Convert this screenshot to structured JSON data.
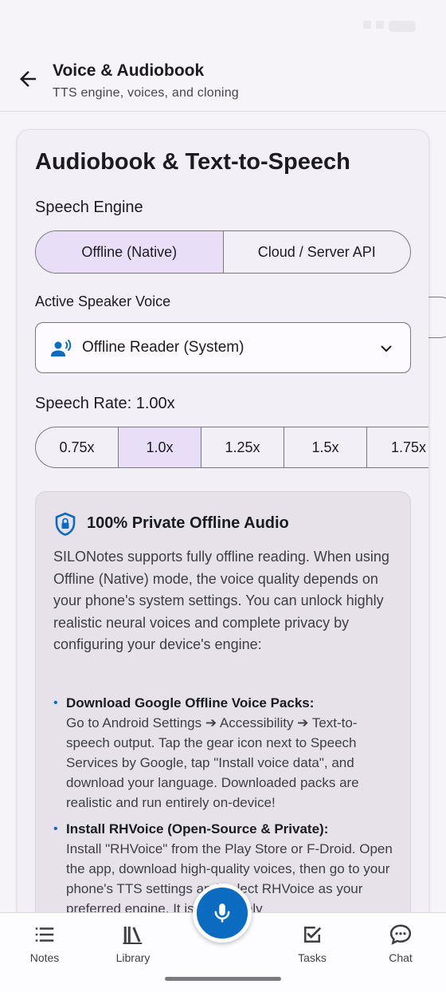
{
  "header": {
    "title": "Voice & Audiobook",
    "subtitle": "TTS engine, voices, and cloning",
    "back_icon": "arrow-left-icon"
  },
  "card": {
    "title": "Audiobook & Text-to-Speech",
    "engine": {
      "label": "Speech Engine",
      "options": [
        "Offline (Native)",
        "Cloud / Server API"
      ],
      "selected": "Offline (Native)"
    },
    "voice": {
      "label": "Active Speaker Voice",
      "value": "Offline Reader (System)",
      "icon": "record-voice-icon"
    },
    "rate": {
      "label": "Speech Rate: 1.00x",
      "options": [
        "0.75x",
        "1.0x",
        "1.25x",
        "1.5x",
        "1.75x"
      ],
      "selected": "1.0x"
    },
    "info": {
      "icon": "shield-lock-icon",
      "title": "100% Private Offline Audio",
      "intro": "SILONotes supports fully offline reading. When using Offline (Native) mode, the voice quality depends on your phone's system settings. You can unlock highly realistic neural voices and complete privacy by configuring your device's engine:",
      "items": [
        {
          "title": "Download Google Offline Voice Packs:",
          "body": "Go to Android Settings ➔ Accessibility ➔ Text-to-speech output. Tap the gear icon next to Speech Services by Google, tap \"Install voice data\", and download your language. Downloaded packs are realistic and run entirely on-device!"
        },
        {
          "title": "Install RHVoice (Open-Source & Private):",
          "body": "Install \"RHVoice\" from the Play Store or F-Droid. Open the app, download high-quality voices, then go to your phone's TTS settings and select RHVoice as your preferred engine. It is completely"
        }
      ]
    }
  },
  "nav": {
    "items": [
      {
        "label": "Notes",
        "icon": "notes-list-icon"
      },
      {
        "label": "Library",
        "icon": "library-books-icon"
      },
      {
        "label": "Tasks",
        "icon": "check-box-icon"
      },
      {
        "label": "Chat",
        "icon": "chat-bubble-icon"
      }
    ],
    "fab_icon": "microphone-icon"
  },
  "colors": {
    "accent": "#0b6bbf",
    "selected_bg": "#e8def8",
    "background": "#f6f4f8",
    "info_bg": "#e7e1ea"
  }
}
